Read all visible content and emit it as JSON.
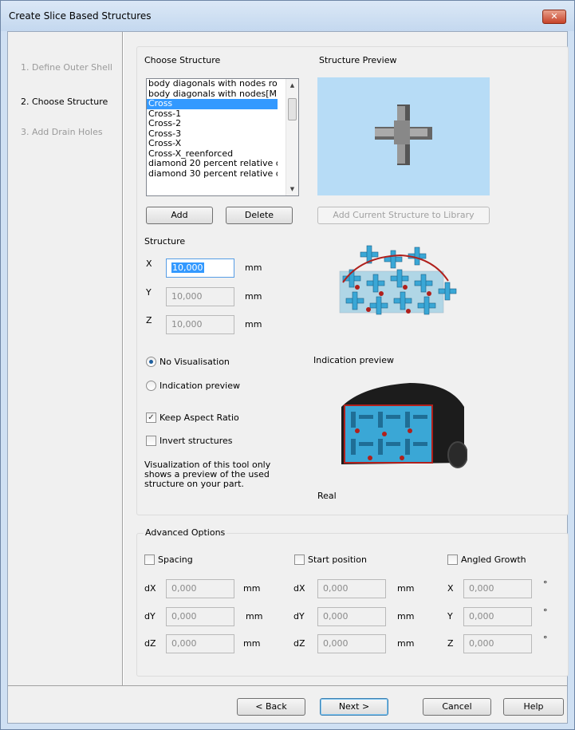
{
  "window": {
    "title": "Create Slice Based Structures",
    "close_label": "✕"
  },
  "steps": [
    {
      "label": "1. Define Outer Shell"
    },
    {
      "label": "2. Choose Structure"
    },
    {
      "label": "3. Add Drain Holes"
    }
  ],
  "choose": {
    "heading": "Choose Structure",
    "items": [
      "body diagonals with nodes ro",
      "body diagonals with nodes[M",
      "Cross",
      "Cross-1",
      "Cross-2",
      "Cross-3",
      "Cross-X",
      "Cross-X_reenforced",
      "diamond 20 percent relative c",
      "diamond 30 percent relative c"
    ],
    "selected_index": 2,
    "add_label": "Add",
    "delete_label": "Delete"
  },
  "preview": {
    "heading": "Structure Preview",
    "add_library_label": "Add Current Structure to Library"
  },
  "structure": {
    "heading": "Structure",
    "x_label": "X",
    "x_value": "10,000",
    "y_label": "Y",
    "y_value": "10,000",
    "z_label": "Z",
    "z_value": "10,000",
    "unit": "mm"
  },
  "visual": {
    "no_vis_label": "No Visualisation",
    "ind_prev_label": "Indication preview",
    "keep_aspect_label": "Keep Aspect Ratio",
    "invert_label": "Invert structures",
    "note": "Visualization of this tool only shows a preview of the used structure on your part.",
    "indication_caption": "Indication preview",
    "real_caption": "Real"
  },
  "advanced": {
    "heading": "Advanced Options",
    "spacing_label": "Spacing",
    "start_label": "Start position",
    "angled_label": "Angled Growth",
    "dx": "dX",
    "dy": "dY",
    "dz": "dZ",
    "x": "X",
    "y": "Y",
    "z": "Z",
    "value": "0,000",
    "unit": "mm",
    "deg": "°"
  },
  "footer": {
    "back": "< Back",
    "next": "Next >",
    "cancel": "Cancel",
    "help": "Help"
  }
}
